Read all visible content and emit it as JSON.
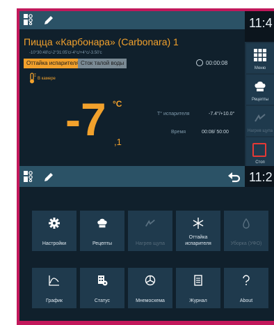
{
  "screen1": {
    "clock": "11:4",
    "recipe_title": "Пицца «Карбонара» (Carbonara) 1",
    "recipe_sub": "-10°30:48'с/-2°31:05'с/-4°с/+4°с/-3.50'с",
    "tabs": [
      "Оттайка испарителя",
      "Сток талой воды"
    ],
    "timer": "00:00:08",
    "chamber_label": "В камере",
    "temp_big": "-7",
    "temp_unit": "°C",
    "temp_frac": ",1",
    "evap_label": "T° испарителя",
    "evap_value": "-7.4°/+10.0°",
    "time_label": "Время",
    "time_value": "00:08/ 50:00",
    "side": {
      "menu": "Меню",
      "recipes": "Рецепты",
      "probe_heat": "Нагрев щупа",
      "stop": "Стоп"
    }
  },
  "screen2": {
    "clock": "11:2",
    "tiles": [
      {
        "label": "Настройки",
        "icon": "gear-icon",
        "enabled": true
      },
      {
        "label": "Рецепты",
        "icon": "chef-hat-icon",
        "enabled": true
      },
      {
        "label": "Нагрев щупа",
        "icon": "probe-icon",
        "enabled": false
      },
      {
        "label": "Оттайка испарителя",
        "icon": "snowflake-icon",
        "enabled": true
      },
      {
        "label": "Уборка (УФО)",
        "icon": "cleaning-icon",
        "enabled": false
      },
      {
        "label": "График",
        "icon": "chart-icon",
        "enabled": true
      },
      {
        "label": "Статус",
        "icon": "status-icon",
        "enabled": true
      },
      {
        "label": "Мнемосхема",
        "icon": "mnemonic-icon",
        "enabled": true
      },
      {
        "label": "Журнал",
        "icon": "journal-icon",
        "enabled": true
      },
      {
        "label": "About",
        "icon": "question-icon",
        "enabled": true
      }
    ]
  },
  "colors": {
    "accent": "#f2a12c",
    "frame": "#c2185b",
    "header": "#2b5266",
    "tile": "#1f3a4d",
    "stop": "#e53935"
  }
}
